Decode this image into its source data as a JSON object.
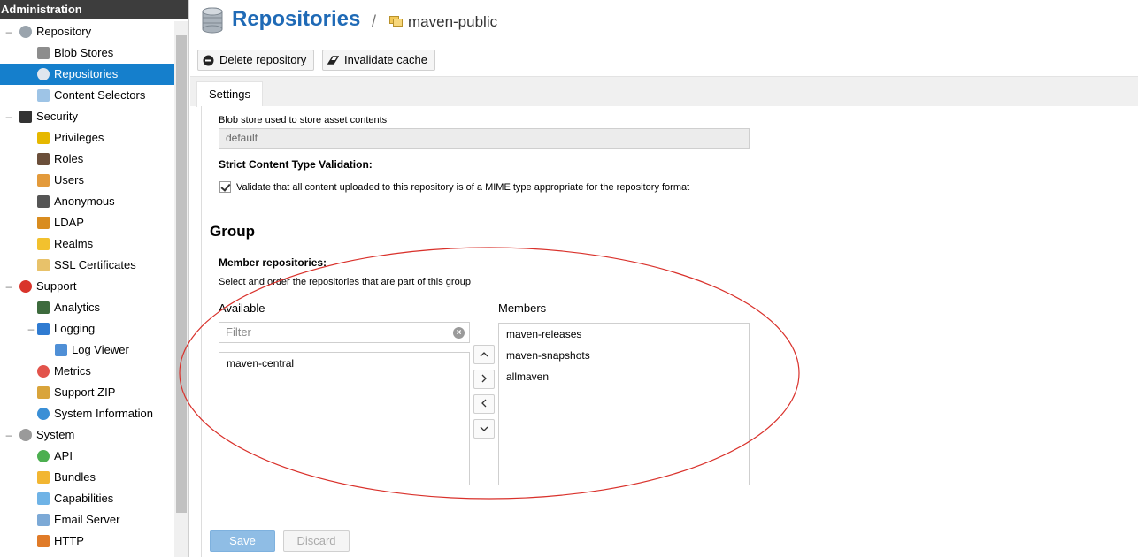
{
  "sidebar": {
    "header": "Administration",
    "items": [
      {
        "label": "Repository",
        "level": 0,
        "toggle": "–",
        "icon": "database-icon",
        "color": "#9aa4ad"
      },
      {
        "label": "Blob Stores",
        "level": 1,
        "icon": "blob-store-icon",
        "color": "#8d8d8d"
      },
      {
        "label": "Repositories",
        "level": 1,
        "icon": "database-icon",
        "color": "#dfe6ee",
        "selected": true
      },
      {
        "label": "Content Selectors",
        "level": 1,
        "icon": "content-selector-icon",
        "color": "#9ec4e6"
      },
      {
        "label": "Security",
        "level": 0,
        "toggle": "–",
        "icon": "security-badge-icon",
        "color": "#333333"
      },
      {
        "label": "Privileges",
        "level": 1,
        "icon": "medal-icon",
        "color": "#e6b800"
      },
      {
        "label": "Roles",
        "level": 1,
        "icon": "role-user-icon",
        "color": "#6b4f3a"
      },
      {
        "label": "Users",
        "level": 1,
        "icon": "users-icon",
        "color": "#e39a3b"
      },
      {
        "label": "Anonymous",
        "level": 1,
        "icon": "anonymous-icon",
        "color": "#555555"
      },
      {
        "label": "LDAP",
        "level": 1,
        "icon": "ldap-book-icon",
        "color": "#d98c1f"
      },
      {
        "label": "Realms",
        "level": 1,
        "icon": "shield-icon",
        "color": "#f2c12e"
      },
      {
        "label": "SSL Certificates",
        "level": 1,
        "icon": "certificate-icon",
        "color": "#e8c26a"
      },
      {
        "label": "Support",
        "level": 0,
        "toggle": "–",
        "icon": "lifebuoy-icon",
        "color": "#d9342b"
      },
      {
        "label": "Analytics",
        "level": 1,
        "icon": "analytics-monitor-icon",
        "color": "#3d6b3d"
      },
      {
        "label": "Logging",
        "level": 1,
        "toggle": "–",
        "icon": "logging-book-icon",
        "color": "#2f7bd1"
      },
      {
        "label": "Log Viewer",
        "level": 2,
        "icon": "log-scroll-icon",
        "color": "#4f8fd6"
      },
      {
        "label": "Metrics",
        "level": 1,
        "icon": "pie-chart-icon",
        "color": "#e2534b"
      },
      {
        "label": "Support ZIP",
        "level": 1,
        "icon": "zip-icon",
        "color": "#d9a43b"
      },
      {
        "label": "System Information",
        "level": 1,
        "icon": "globe-icon",
        "color": "#3a8fd6"
      },
      {
        "label": "System",
        "level": 0,
        "toggle": "–",
        "icon": "gear-icon",
        "color": "#9a9a9a"
      },
      {
        "label": "API",
        "level": 1,
        "icon": "api-icon",
        "color": "#4caf50"
      },
      {
        "label": "Bundles",
        "level": 1,
        "icon": "puzzle-icon",
        "color": "#f2b632"
      },
      {
        "label": "Capabilities",
        "level": 1,
        "icon": "cube-icon",
        "color": "#6fb3e6"
      },
      {
        "label": "Email Server",
        "level": 1,
        "icon": "envelope-icon",
        "color": "#7ca9d6"
      },
      {
        "label": "HTTP",
        "level": 1,
        "icon": "truck-icon",
        "color": "#e07b28"
      }
    ]
  },
  "header": {
    "title": "Repositories",
    "separator": "/",
    "repo_name": "maven-public"
  },
  "toolbar": {
    "delete_label": "Delete repository",
    "invalidate_label": "Invalidate cache"
  },
  "tabs": [
    {
      "label": "Settings"
    }
  ],
  "form": {
    "blob_store_label": "Blob store used to store asset contents",
    "blob_store_value": "default",
    "strict_label": "Strict Content Type Validation:",
    "strict_checkbox_label": "Validate that all content uploaded to this repository is of a MIME type appropriate for the repository format",
    "group_heading": "Group",
    "member_label": "Member repositories:",
    "member_help": "Select and order the repositories that are part of this group",
    "available_label": "Available",
    "members_label": "Members",
    "filter_placeholder": "Filter",
    "available_items": [
      "maven-central"
    ],
    "member_items": [
      "maven-releases",
      "maven-snapshots",
      "allmaven"
    ],
    "arrow_up": "^",
    "arrow_right": ">",
    "arrow_left": "<",
    "arrow_down": "v"
  },
  "actions": {
    "save_label": "Save",
    "discard_label": "Discard"
  },
  "annotation_color": "#d9312b"
}
